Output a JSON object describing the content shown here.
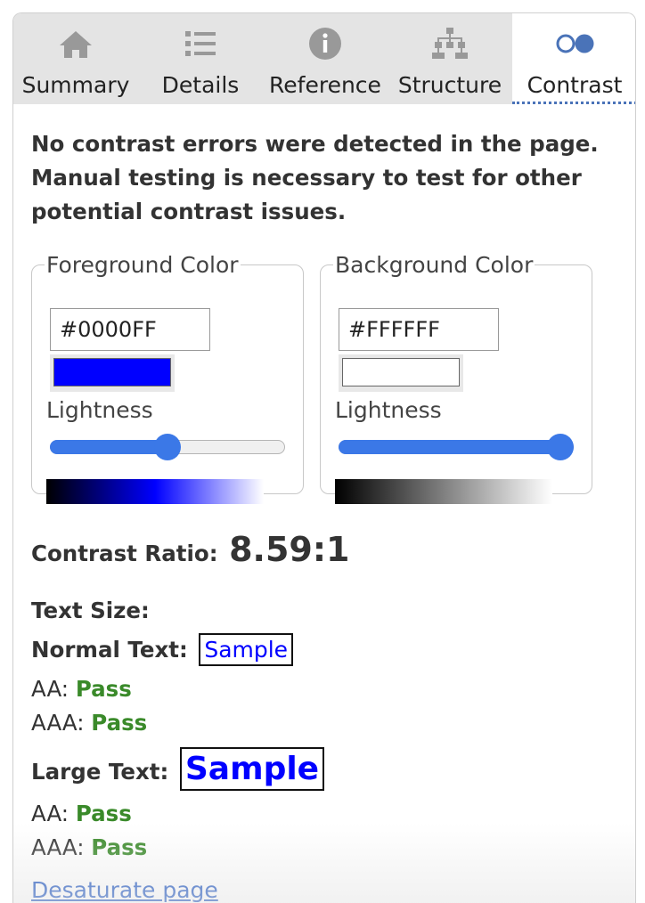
{
  "tabs": [
    {
      "label": "Summary",
      "icon": "home-icon",
      "active": false
    },
    {
      "label": "Details",
      "icon": "list-icon",
      "active": false
    },
    {
      "label": "Reference",
      "icon": "info-icon",
      "active": false
    },
    {
      "label": "Structure",
      "icon": "hierarchy-icon",
      "active": false
    },
    {
      "label": "Contrast",
      "icon": "contrast-circles-icon",
      "active": true
    }
  ],
  "summary_message": "No contrast errors were detected in the page. Manual testing is necessary to test for other potential contrast issues.",
  "foreground": {
    "legend": "Foreground Color",
    "hex": "#0000FF",
    "swatch_color": "#0000FF",
    "lightness_label": "Lightness",
    "lightness": 0.5
  },
  "background": {
    "legend": "Background Color",
    "hex": "#FFFFFF",
    "swatch_color": "#FFFFFF",
    "lightness_label": "Lightness",
    "lightness": 1.0
  },
  "contrast": {
    "ratio_label": "Contrast Ratio:",
    "ratio_value": "8.59:1",
    "text_size_label": "Text Size:",
    "normal": {
      "label": "Normal Text:",
      "sample": "Sample",
      "aa_label": "AA:",
      "aa_result": "Pass",
      "aaa_label": "AAA:",
      "aaa_result": "Pass"
    },
    "large": {
      "label": "Large Text:",
      "sample": "Sample",
      "aa_label": "AA:",
      "aa_result": "Pass",
      "aaa_label": "AAA:",
      "aaa_result": "Pass"
    }
  },
  "desaturate_link": "Desaturate page",
  "colors": {
    "accent": "#3B78E7",
    "pass": "#3A8A2A",
    "link": "#1A52C0",
    "tab_bar": "#E4E4E4",
    "inactive_icon": "#999999",
    "active_icon": "#4A73B8"
  }
}
